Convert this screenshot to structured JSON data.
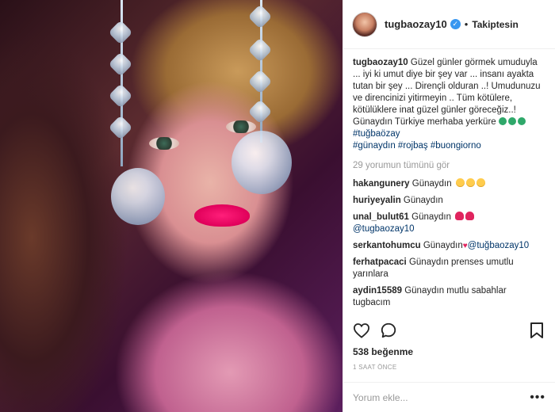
{
  "post": {
    "username": "tugbaozay10",
    "follow_status": "Takiptesin",
    "caption_username": "tugbaozay10",
    "caption_text": "Güzel günler görmek umuduyla ... iyi ki umut diye bir şey var ... insanı ayakta tutan bir şey ... Dirençli olduran ..! Umudunuzu ve direncinizi yitirmeyin .. Tüm kötülere, kötülüklere inat güzel günler göreceğiz..! Günaydın Türkiye merhaba yerküre",
    "hashtags_inline": "#tuğbaözay",
    "hashtags_line": [
      "#günaydın",
      "#rojbaş",
      "#buongiorno"
    ],
    "view_all_comments": "29 yorumun tümünü gör",
    "likes": "538 beğenme",
    "time": "1 SAAT ÖNCE",
    "comment_placeholder": "Yorum ekle..."
  },
  "comments": [
    {
      "user": "hakangunery",
      "text": "Günaydın"
    },
    {
      "user": "huriyeyalin",
      "text": "Günaydın"
    },
    {
      "user": "unal_bulut61",
      "text": "Günaydın",
      "mention": "@tugbaozay10"
    },
    {
      "user": "serkantohumcu",
      "text": "Günaydın",
      "mention": "@tuğbaozay10"
    },
    {
      "user": "ferhatpacaci",
      "text": "Günaydın prenses umutlu yarınlara"
    },
    {
      "user": "aydin15589",
      "text": "Günaydın mutlu sabahlar tugbacım"
    }
  ],
  "icons": {
    "verified": "verified-badge-icon",
    "comment": "comment-bubble-icon",
    "save": "bookmark-icon",
    "more": "more-options-icon"
  },
  "colors": {
    "link": "#003569",
    "verified": "#3897f0",
    "muted": "#999999"
  }
}
